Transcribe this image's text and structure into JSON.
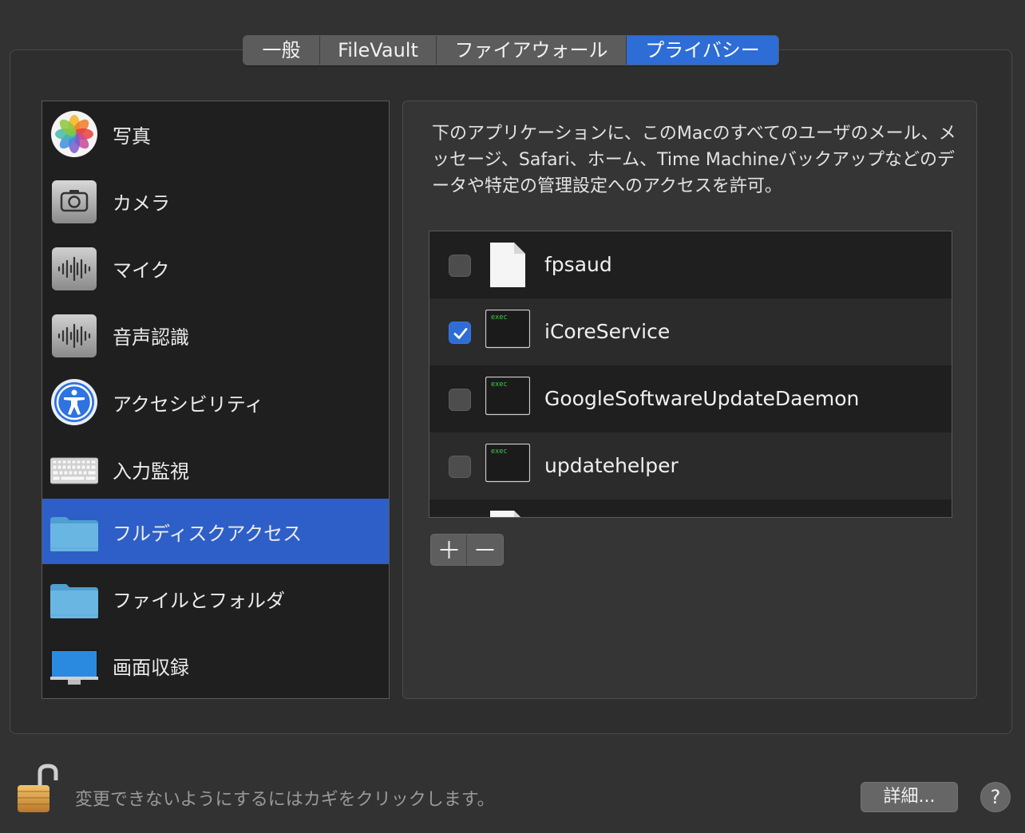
{
  "tabs": [
    "一般",
    "FileVault",
    "ファイアウォール",
    "プライバシー"
  ],
  "active_tab": "プライバシー",
  "categories": [
    {
      "label": "写真",
      "icon": "photos-icon"
    },
    {
      "label": "カメラ",
      "icon": "camera-icon"
    },
    {
      "label": "マイク",
      "icon": "microphone-icon"
    },
    {
      "label": "音声認識",
      "icon": "speech-recognition-icon"
    },
    {
      "label": "アクセシビリティ",
      "icon": "accessibility-icon"
    },
    {
      "label": "入力監視",
      "icon": "keyboard-icon"
    },
    {
      "label": "フルディスクアクセス",
      "icon": "folder-icon"
    },
    {
      "label": "ファイルとフォルダ",
      "icon": "folder-icon"
    },
    {
      "label": "画面収録",
      "icon": "display-icon"
    }
  ],
  "selected_category": "フルディスクアクセス",
  "description": "下のアプリケーションに、このMacのすべてのユーザのメール、メッセージ、Safari、ホーム、Time Machineバックアップなどのデータや特定の管理設定へのアクセスを許可。",
  "apps": [
    {
      "name": "fpsaud",
      "checked": false,
      "icon": "document-icon"
    },
    {
      "name": "iCoreService",
      "checked": true,
      "icon": "exec-icon"
    },
    {
      "name": "GoogleSoftwareUpdateDaemon",
      "checked": false,
      "icon": "exec-icon"
    },
    {
      "name": "updatehelper",
      "checked": false,
      "icon": "exec-icon"
    }
  ],
  "exec_icon_label": "exec",
  "footer": {
    "lock_text": "変更できないようにするにはカギをクリックします。",
    "advanced_label": "詳細...",
    "help_label": "?"
  },
  "colors": {
    "accent": "#2e6cd6",
    "selection": "#2e5fc8"
  }
}
